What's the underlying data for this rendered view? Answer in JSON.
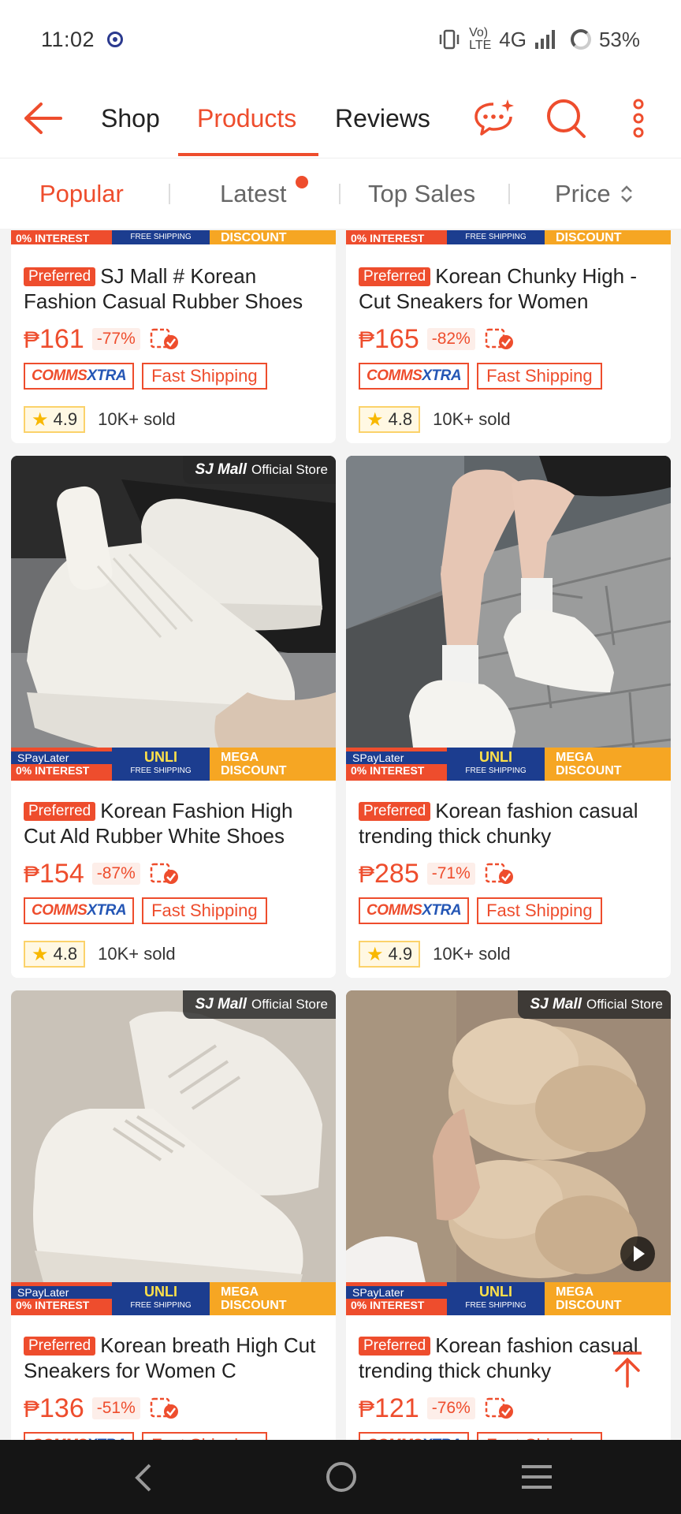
{
  "status_bar": {
    "time": "11:02",
    "network_vo": "Vo)",
    "network_lte": "LTE",
    "network": "4G",
    "battery": "53%"
  },
  "tabs": {
    "shop": "Shop",
    "products": "Products",
    "reviews": "Reviews"
  },
  "sort": {
    "popular": "Popular",
    "latest": "Latest",
    "top_sales": "Top Sales",
    "price": "Price"
  },
  "promo": {
    "spaylater": "SPayLater",
    "interest": "0% INTEREST",
    "unli": "UNLI",
    "free_shipping": "FREE SHIPPING",
    "mega": "MEGA",
    "discount": "DISCOUNT"
  },
  "store_badge": {
    "brand": "SJ Mall",
    "label": "Official Store"
  },
  "tags": {
    "preferred": "Preferred",
    "comms_a": "COMMS",
    "comms_b": "XTRA",
    "fast": "Fast Shipping",
    "currency": "₱"
  },
  "products": [
    {
      "title": "SJ Mall # Korean Fashion Casual Rubber Shoes",
      "price": "161",
      "discount": "-77%",
      "rating": "4.9",
      "sold": "10K+ sold"
    },
    {
      "title": "Korean Chunky High -Cut Sneakers for Women",
      "price": "165",
      "discount": "-82%",
      "rating": "4.8",
      "sold": "10K+ sold"
    },
    {
      "title": "Korean Fashion High Cut Ald Rubber White Shoes",
      "price": "154",
      "discount": "-87%",
      "rating": "4.8",
      "sold": "10K+ sold"
    },
    {
      "title": "Korean fashion casual trending thick chunky",
      "price": "285",
      "discount": "-71%",
      "rating": "4.9",
      "sold": "10K+ sold"
    },
    {
      "title": "Korean breath High Cut Sneakers for Women C",
      "price": "136",
      "discount": "-51%"
    },
    {
      "title": "Korean fashion casual trending thick chunky",
      "price": "121",
      "discount": "-76%"
    }
  ],
  "colors": {
    "accent": "#ee4d2d",
    "rating_star": "#f8b800",
    "promo_blue": "#1c3d8f",
    "promo_orange": "#f6a623"
  }
}
